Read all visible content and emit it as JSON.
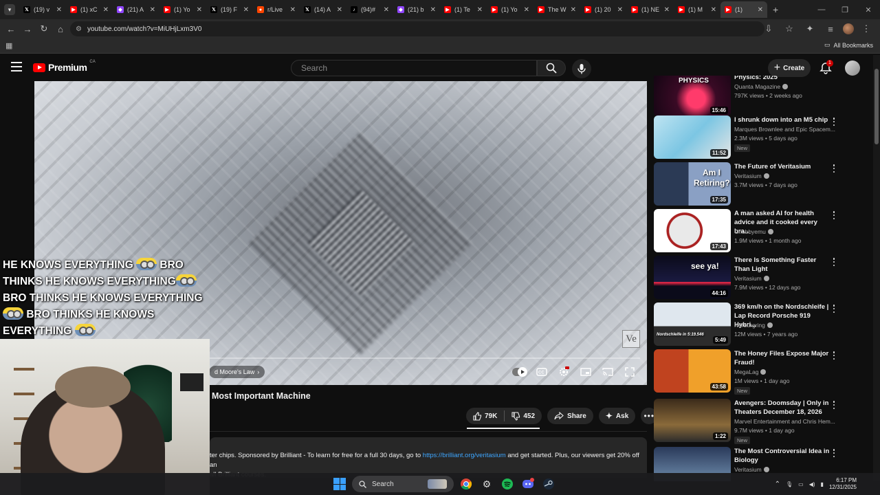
{
  "browser": {
    "tabs": [
      {
        "label": "(19) v",
        "icon": "x-icon",
        "color": "#000000"
      },
      {
        "label": "(1) xC",
        "icon": "youtube-icon",
        "color": "#ff0000"
      },
      {
        "label": "(21) A",
        "icon": "twitch-icon",
        "color": "#9146ff"
      },
      {
        "label": "(1) Yo",
        "icon": "youtube-icon",
        "color": "#ff0000"
      },
      {
        "label": "(19) F",
        "icon": "x-icon",
        "color": "#000000"
      },
      {
        "label": "r/Live",
        "icon": "reddit-icon",
        "color": "#ff4500"
      },
      {
        "label": "(14) A",
        "icon": "x-icon",
        "color": "#000000"
      },
      {
        "label": "(94)#",
        "icon": "tiktok-icon",
        "color": "#000000"
      },
      {
        "label": "(21) b",
        "icon": "twitch-icon",
        "color": "#9146ff"
      },
      {
        "label": "(1) Te",
        "icon": "youtube-icon",
        "color": "#ff0000"
      },
      {
        "label": "(1) Yo",
        "icon": "youtube-icon",
        "color": "#ff0000"
      },
      {
        "label": "The W",
        "icon": "youtube-icon",
        "color": "#ff0000"
      },
      {
        "label": "(1) 20",
        "icon": "youtube-icon",
        "color": "#ff0000"
      },
      {
        "label": "(1) NE",
        "icon": "youtube-icon",
        "color": "#ff0000"
      },
      {
        "label": "(1) M",
        "icon": "youtube-icon",
        "color": "#ff0000"
      },
      {
        "label": "(1)",
        "icon": "youtube-icon",
        "color": "#ff0000"
      }
    ],
    "url": "youtube.com/watch?v=MiUHjLxm3V0",
    "bookmarks_label": "All Bookmarks"
  },
  "header": {
    "brand": "Premium",
    "region": "CA",
    "search_placeholder": "Search",
    "create_label": "Create",
    "notification_count": "1"
  },
  "player": {
    "chapter": "d Moore's Law",
    "watermark": "Ve"
  },
  "overlay": {
    "line1": "HE KNOWS EVERYTHING",
    "line2a": "BRO",
    "line2b": "THINKS HE KNOWS EVERYTHING",
    "line3": "BRO THINKS HE KNOWS EVERYTHING",
    "line4": "BRO THINKS HE KNOWS",
    "line5": "EVERYTHING"
  },
  "video": {
    "title": "Most Important Machine",
    "likes": "79K",
    "dislikes": "452",
    "share_label": "Share",
    "ask_label": "Ask",
    "description_pre": "ter chips. Sponsored by Brilliant - To learn for free for a full 30 days, go to ",
    "description_link": "https://brilliant.org/veritasium",
    "description_post": " and get started. Plus, our viewers get 20% off an",
    "description_line2": "all Brilliant courses."
  },
  "recommendations": [
    {
      "title": "Physics: 2025",
      "channel": "Quanta Magazine",
      "meta": "797K views • 2 weeks ago",
      "duration": "15:46",
      "thumb_text": "PHYSICS",
      "new": false
    },
    {
      "title": "I shrunk down into an M5 chip",
      "channel": "Marques Brownlee and Epic Spacem...",
      "meta": "2.3M views • 5 days ago",
      "duration": "11:52",
      "thumb_text": "",
      "new": true
    },
    {
      "title": "The Future of Veritasium",
      "channel": "Veritasium",
      "meta": "3.7M views • 7 days ago",
      "duration": "17:35",
      "thumb_text": "Am I Retiring?",
      "new": false
    },
    {
      "title": "A man asked AI for health advice and it cooked every bra...",
      "channel": "Chubbyemu",
      "meta": "1.9M views • 1 month ago",
      "duration": "17:43",
      "thumb_text": "",
      "new": false
    },
    {
      "title": "There Is Something Faster Than Light",
      "channel": "Veritasium",
      "meta": "7.9M views • 12 days ago",
      "duration": "44:16",
      "thumb_text": "see ya!",
      "new": false
    },
    {
      "title": "369 km/h on the Nordschleife | Lap Record Porsche 919 Hybri...",
      "channel": "Nürburgring",
      "meta": "12M views • 7 years ago",
      "duration": "5:49",
      "thumb_text": "Nordschleife in 5:19.546",
      "new": false
    },
    {
      "title": "The Honey Files Expose Major Fraud!",
      "channel": "MegaLag",
      "meta": "1M views • 1 day ago",
      "duration": "43:58",
      "thumb_text": "",
      "new": true
    },
    {
      "title": "Avengers: Doomsday | Only in Theaters December 18, 2026",
      "channel": "Marvel Entertainment and Chris Hem...",
      "meta": "9.7M views • 1 day ago",
      "duration": "1:22",
      "thumb_text": "",
      "new": true
    },
    {
      "title": "The Most Controversial Idea in Biology",
      "channel": "Veritasium",
      "meta": "",
      "duration": "",
      "thumb_text": "",
      "new": false
    }
  ],
  "new_badge": "New",
  "taskbar": {
    "search_label": "Search",
    "time": "6:17 PM",
    "date": "12/31/2025"
  }
}
